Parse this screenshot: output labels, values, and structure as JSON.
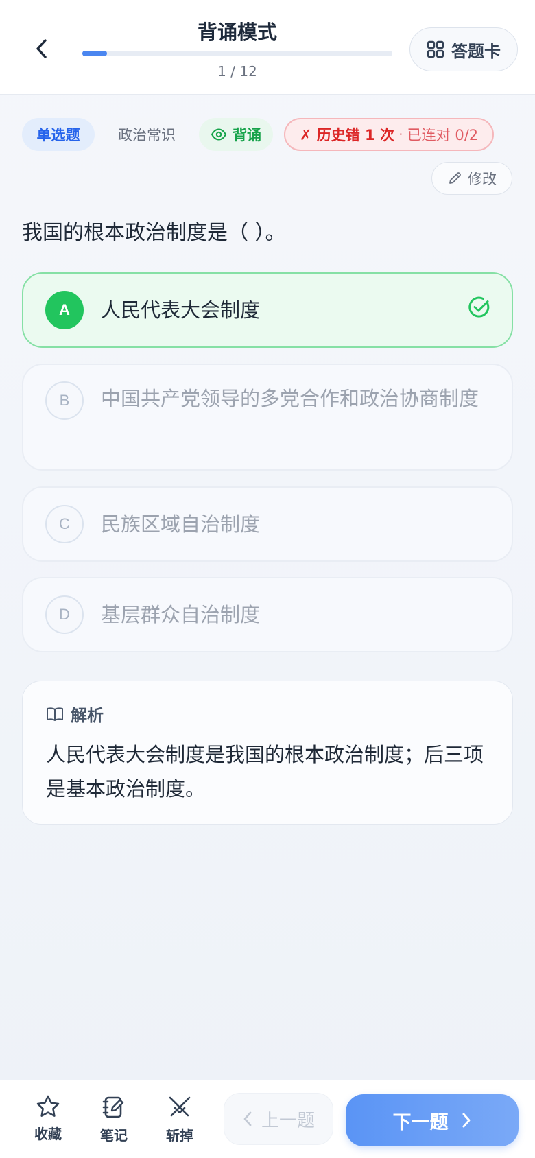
{
  "header": {
    "title": "背诵模式",
    "progress_text": "1 / 12",
    "progress": 0.08,
    "answer_card_label": "答题卡"
  },
  "tags": {
    "type": "单选题",
    "subject": "政治常识",
    "mode": "背诵",
    "history_wrong": "✗ 历史错 1 次",
    "separator": "·",
    "streak": "已连对 0/2"
  },
  "edit_label": "修改",
  "question": {
    "text": "我国的根本政治制度是（ ）。",
    "options": [
      {
        "letter": "A",
        "text": "人民代表大会制度",
        "correct": true
      },
      {
        "letter": "B",
        "text": "中国共产党领导的多党合作和政治协商制度"
      },
      {
        "letter": "C",
        "text": "民族区域自治制度"
      },
      {
        "letter": "D",
        "text": "基层群众自治制度"
      }
    ]
  },
  "analysis": {
    "title": "解析",
    "text": "人民代表大会制度是我国的根本政治制度；后三项是基本政治制度。"
  },
  "bottom_bar": {
    "favorite_label": "收藏",
    "note_label": "笔记",
    "eliminate_label": "斩掉",
    "prev_label": "上一题",
    "next_label": "下一题"
  },
  "colors": {
    "accent": "#4a86f0",
    "correct": "#22c55e",
    "wrong": "#dc2626"
  }
}
